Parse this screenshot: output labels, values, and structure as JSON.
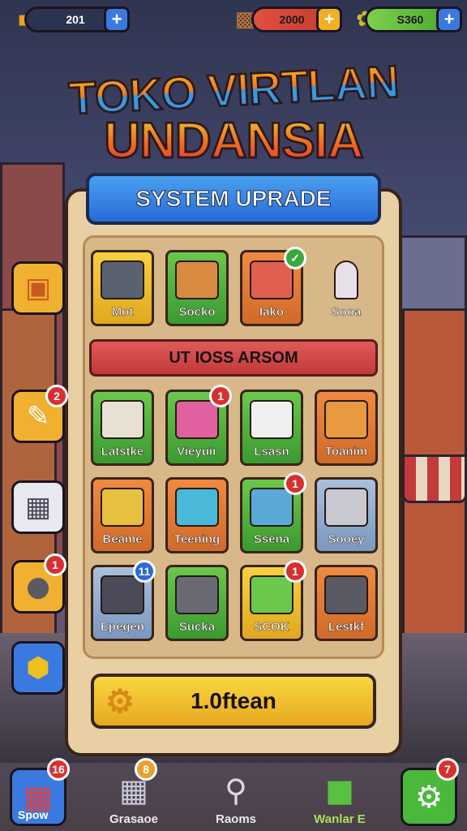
{
  "currency": {
    "left_value": "201",
    "mid_value": "2000",
    "right_value": "S360"
  },
  "title": {
    "line1": "TOKO VIRTLAN",
    "line2": "UNDANSIA"
  },
  "panel": {
    "header": "SYSTEM UPRADE",
    "section": "UT IOSS ARSOM",
    "tiles_row1": [
      "Mot",
      "Socko",
      "Iako",
      "Sooa"
    ],
    "tiles_row2": [
      "Latstke",
      "Vieyuir",
      "Lsasn",
      "Toanim"
    ],
    "tiles_row3": [
      "Beame",
      "Teening",
      "Ssena",
      "Sooey"
    ],
    "tiles_row4": [
      "Epegen",
      "Sucka",
      "SCOK",
      "Lestkf"
    ],
    "badges": {
      "r2c2": "1",
      "r3c3": "1",
      "r4c1": "11",
      "r4c3": "1"
    },
    "cta_label": "1.0ftean"
  },
  "side_badges": {
    "pen": "2",
    "disc": "1"
  },
  "bottom_nav": {
    "items": [
      "Spow",
      "Grasaoe",
      "Raoms",
      "Wanlar E",
      ""
    ],
    "badges": [
      "16",
      "8",
      "",
      "",
      "7"
    ]
  },
  "colors": {
    "accent_blue": "#2a6ad8",
    "accent_yellow": "#f0b020",
    "badge_red": "#d83030"
  }
}
